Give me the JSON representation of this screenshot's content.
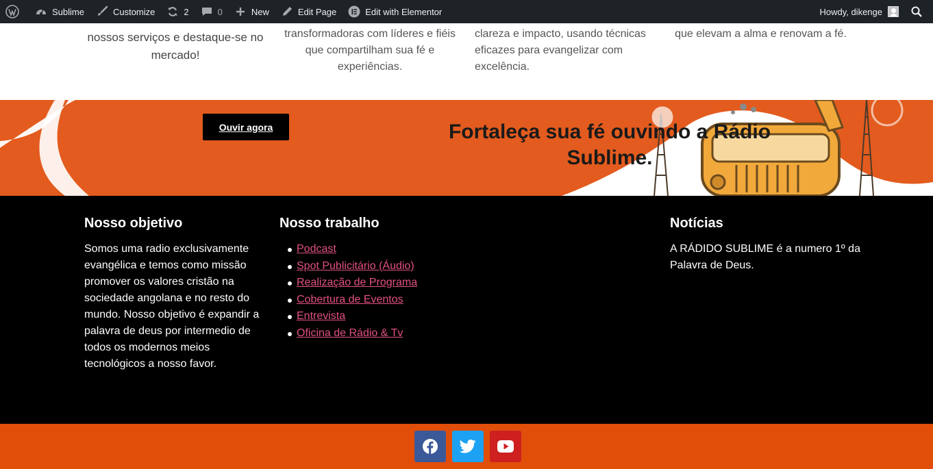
{
  "adminbar": {
    "site_name": "Sublime",
    "customize": "Customize",
    "updates_count": "2",
    "comments_count": "0",
    "new": "New",
    "edit_page": "Edit Page",
    "edit_elementor": "Edit with Elementor",
    "howdy": "Howdy, dikenge"
  },
  "services": {
    "col1": "nossos serviços e destaque-se no mercado!",
    "col2": "transformadoras com líderes e fiéis que compartilham sua fé e experiências.",
    "col3": "clareza e impacto, usando técnicas eficazes para evangelizar com excelência.",
    "col4": "que elevam a alma e renovam a fé."
  },
  "banner": {
    "button": "Ouvir agora",
    "title": "Fortaleça sua fé ouvindo a Rádio Sublime."
  },
  "footer": {
    "objetivo_title": "Nosso objetivo",
    "objetivo_text": "Somos uma radio exclusivamente evangélica e temos como missão promover os valores cristão na sociedade angolana e no resto do mundo. Nosso objetivo é expandir a palavra de deus por intermedio de todos os modernos meios tecnológicos a nosso favor.",
    "trabalho_title": "Nosso trabalho",
    "trabalho_items": [
      "Podcast",
      "Spot Publicitário (Áudio)",
      "Realização de Programa",
      "Cobertura de Eventos",
      "Entrevista",
      "Oficina de Rádio & Tv"
    ],
    "noticias_title": "Notícias",
    "noticias_text": "A RÁDIDO SUBLIME é a numero 1º da Palavra de Deus."
  },
  "social": {
    "facebook_color": "#3b5998",
    "twitter_color": "#1da1f2",
    "youtube_color": "#cd201f"
  },
  "colors": {
    "adminbar": "#1d2327",
    "banner": "#e35b1e",
    "footer": "#000000",
    "social_bar": "#e04e0a",
    "link": "#e25181"
  }
}
